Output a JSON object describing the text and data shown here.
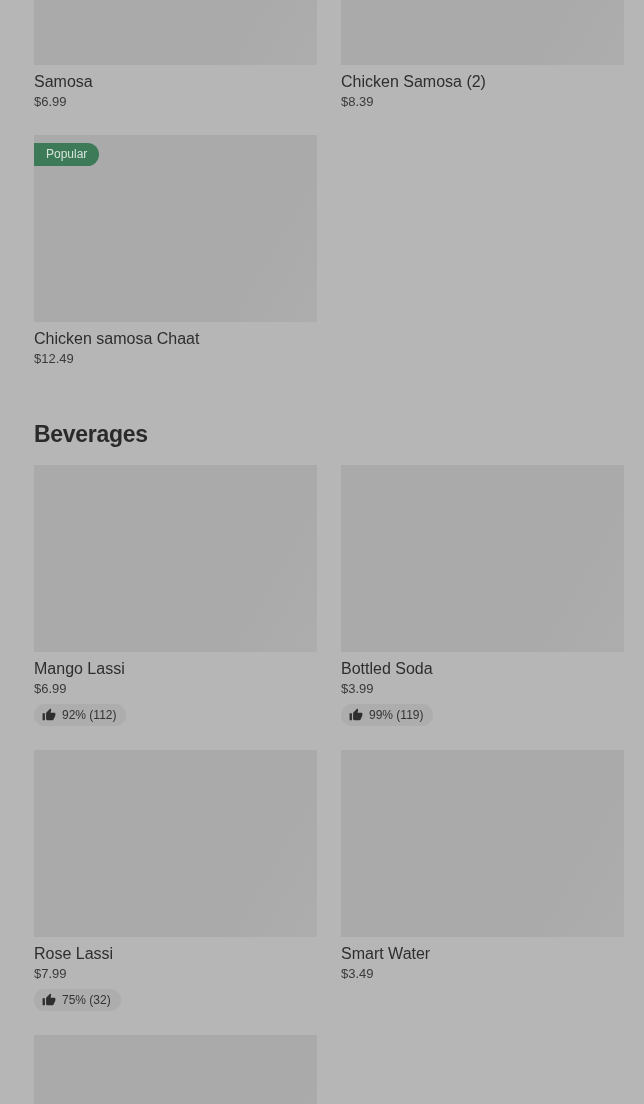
{
  "sections": [
    {
      "items": [
        {
          "kind": "dish",
          "name": "Samosa",
          "price": "$6.99"
        },
        {
          "kind": "dish",
          "name": "Chicken Samosa (2)",
          "price": "$8.39"
        },
        {
          "kind": "dish",
          "name": "Chicken samosa Chaat",
          "price": "$12.49",
          "badge": "Popular"
        }
      ]
    },
    {
      "title": "Beverages",
      "items": [
        {
          "kind": "dish",
          "name": "Mango Lassi",
          "price": "$6.99",
          "rating": "92% (112)"
        },
        {
          "kind": "dish",
          "name": "Bottled Soda",
          "price": "$3.99",
          "rating": "99% (119)"
        },
        {
          "kind": "dish",
          "name": "Rose Lassi",
          "price": "$7.99",
          "rating": "75% (32)"
        },
        {
          "kind": "dish",
          "name": "Smart Water",
          "price": "$3.49"
        },
        {
          "kind": "image_only"
        }
      ]
    }
  ]
}
